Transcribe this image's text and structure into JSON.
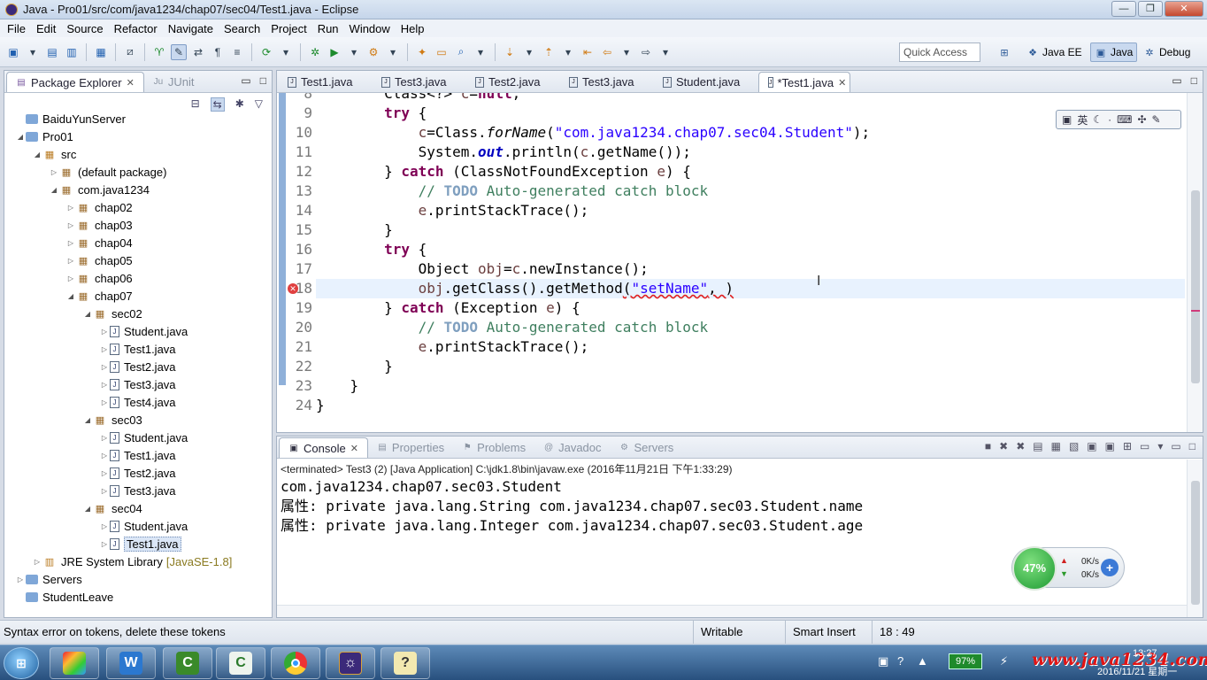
{
  "window": {
    "title": "Java - Pro01/src/com/java1234/chap07/sec04/Test1.java - Eclipse"
  },
  "menu": [
    "File",
    "Edit",
    "Source",
    "Refactor",
    "Navigate",
    "Search",
    "Project",
    "Run",
    "Window",
    "Help"
  ],
  "toolbar": {
    "quick_access_placeholder": "Quick Access",
    "perspectives": [
      "Java EE",
      "Java",
      "Debug"
    ],
    "active_perspective": "Java"
  },
  "explorer": {
    "tabs": [
      "Package Explorer",
      "JUnit"
    ],
    "tree": [
      {
        "label": "BaiduYunServer",
        "depth": 0,
        "arrow": "",
        "icon": "project"
      },
      {
        "label": "Pro01",
        "depth": 0,
        "arrow": "down",
        "icon": "project"
      },
      {
        "label": "src",
        "depth": 1,
        "arrow": "down",
        "icon": "src"
      },
      {
        "label": "(default package)",
        "depth": 2,
        "arrow": "right",
        "icon": "pkg"
      },
      {
        "label": "com.java1234",
        "depth": 2,
        "arrow": "down",
        "icon": "pkg"
      },
      {
        "label": "chap02",
        "depth": 3,
        "arrow": "right",
        "icon": "pkg"
      },
      {
        "label": "chap03",
        "depth": 3,
        "arrow": "right",
        "icon": "pkg"
      },
      {
        "label": "chap04",
        "depth": 3,
        "arrow": "right",
        "icon": "pkg"
      },
      {
        "label": "chap05",
        "depth": 3,
        "arrow": "right",
        "icon": "pkg"
      },
      {
        "label": "chap06",
        "depth": 3,
        "arrow": "right",
        "icon": "pkg"
      },
      {
        "label": "chap07",
        "depth": 3,
        "arrow": "down",
        "icon": "pkg"
      },
      {
        "label": "sec02",
        "depth": 4,
        "arrow": "down",
        "icon": "pkg"
      },
      {
        "label": "Student.java",
        "depth": 5,
        "arrow": "right",
        "icon": "file"
      },
      {
        "label": "Test1.java",
        "depth": 5,
        "arrow": "right",
        "icon": "file"
      },
      {
        "label": "Test2.java",
        "depth": 5,
        "arrow": "right",
        "icon": "file"
      },
      {
        "label": "Test3.java",
        "depth": 5,
        "arrow": "right",
        "icon": "file"
      },
      {
        "label": "Test4.java",
        "depth": 5,
        "arrow": "right",
        "icon": "file"
      },
      {
        "label": "sec03",
        "depth": 4,
        "arrow": "down",
        "icon": "pkg"
      },
      {
        "label": "Student.java",
        "depth": 5,
        "arrow": "right",
        "icon": "file"
      },
      {
        "label": "Test1.java",
        "depth": 5,
        "arrow": "right",
        "icon": "file"
      },
      {
        "label": "Test2.java",
        "depth": 5,
        "arrow": "right",
        "icon": "file"
      },
      {
        "label": "Test3.java",
        "depth": 5,
        "arrow": "right",
        "icon": "file"
      },
      {
        "label": "sec04",
        "depth": 4,
        "arrow": "down",
        "icon": "pkg"
      },
      {
        "label": "Student.java",
        "depth": 5,
        "arrow": "right",
        "icon": "file"
      },
      {
        "label": "Test1.java",
        "depth": 5,
        "arrow": "right",
        "icon": "file",
        "selected": true
      },
      {
        "label": "JRE System Library",
        "suffix": "[JavaSE-1.8]",
        "depth": 1,
        "arrow": "right",
        "icon": "jre"
      },
      {
        "label": "Servers",
        "depth": 0,
        "arrow": "right",
        "icon": "project"
      },
      {
        "label": "StudentLeave",
        "depth": 0,
        "arrow": "",
        "icon": "project"
      }
    ]
  },
  "editor": {
    "tabs": [
      {
        "label": "Test1.java",
        "active": false
      },
      {
        "label": "Test3.java",
        "active": false
      },
      {
        "label": "Test2.java",
        "active": false
      },
      {
        "label": "Test3.java",
        "active": false
      },
      {
        "label": "Student.java",
        "active": false
      },
      {
        "label": "*Test1.java",
        "active": true
      }
    ],
    "current_line": 18,
    "lines": [
      {
        "n": "8",
        "tokens": [
          [
            "",
            "        "
          ],
          [
            "",
            "Class<?> "
          ],
          [
            "var",
            "c"
          ],
          [
            "",
            "="
          ],
          [
            "kw",
            "null"
          ],
          [
            "",
            ";"
          ]
        ]
      },
      {
        "n": "9",
        "tokens": [
          [
            "",
            "        "
          ],
          [
            "kw",
            "try"
          ],
          [
            "",
            " {"
          ]
        ]
      },
      {
        "n": "10",
        "tokens": [
          [
            "",
            "            "
          ],
          [
            "var",
            "c"
          ],
          [
            "",
            "=Class."
          ],
          [
            "it",
            "forName"
          ],
          [
            "",
            "("
          ],
          [
            "str",
            "\"com.java1234.chap07.sec04.Student\""
          ],
          [
            "",
            ");"
          ]
        ]
      },
      {
        "n": "11",
        "tokens": [
          [
            "",
            "            System."
          ],
          [
            "fld",
            "out"
          ],
          [
            "",
            ".println("
          ],
          [
            "var",
            "c"
          ],
          [
            "",
            ".getName());"
          ]
        ]
      },
      {
        "n": "12",
        "tokens": [
          [
            "",
            "        } "
          ],
          [
            "kw",
            "catch"
          ],
          [
            "",
            " (ClassNotFoundException "
          ],
          [
            "var",
            "e"
          ],
          [
            "",
            ") {"
          ]
        ]
      },
      {
        "n": "13",
        "tokens": [
          [
            "",
            "            "
          ],
          [
            "cm",
            "// "
          ],
          [
            "todo",
            "TODO"
          ],
          [
            "cm",
            " Auto-generated catch block"
          ]
        ]
      },
      {
        "n": "14",
        "tokens": [
          [
            "",
            "            "
          ],
          [
            "var",
            "e"
          ],
          [
            "",
            ".printStackTrace();"
          ]
        ]
      },
      {
        "n": "15",
        "tokens": [
          [
            "",
            "        }"
          ]
        ]
      },
      {
        "n": "16",
        "tokens": [
          [
            "",
            "        "
          ],
          [
            "kw",
            "try"
          ],
          [
            "",
            " {"
          ]
        ]
      },
      {
        "n": "17",
        "tokens": [
          [
            "",
            "            Object "
          ],
          [
            "var",
            "obj"
          ],
          [
            "",
            "="
          ],
          [
            "var",
            "c"
          ],
          [
            "",
            ".newInstance();"
          ]
        ]
      },
      {
        "n": "18",
        "tokens": [
          [
            "",
            "            "
          ],
          [
            "var",
            "obj"
          ],
          [
            "",
            ".getClass().getMethod"
          ],
          [
            "err",
            "("
          ],
          [
            "str err",
            "\"setName\""
          ],
          [
            "err",
            ", )"
          ]
        ]
      },
      {
        "n": "19",
        "tokens": [
          [
            "",
            "        } "
          ],
          [
            "kw",
            "catch"
          ],
          [
            "",
            " (Exception "
          ],
          [
            "var",
            "e"
          ],
          [
            "",
            ") {"
          ]
        ]
      },
      {
        "n": "20",
        "tokens": [
          [
            "",
            "            "
          ],
          [
            "cm",
            "// "
          ],
          [
            "todo",
            "TODO"
          ],
          [
            "cm",
            " Auto-generated catch block"
          ]
        ]
      },
      {
        "n": "21",
        "tokens": [
          [
            "",
            "            "
          ],
          [
            "var",
            "e"
          ],
          [
            "",
            ".printStackTrace();"
          ]
        ]
      },
      {
        "n": "22",
        "tokens": [
          [
            "",
            "        }"
          ]
        ]
      },
      {
        "n": "23",
        "tokens": [
          [
            "",
            "    }"
          ]
        ]
      },
      {
        "n": "24",
        "tokens": [
          [
            "",
            "}"
          ]
        ]
      }
    ],
    "ime_label": "英"
  },
  "console": {
    "tabs": [
      "Console",
      "Properties",
      "Problems",
      "Javadoc",
      "Servers"
    ],
    "terminated": "<terminated> Test3 (2) [Java Application] C:\\jdk1.8\\bin\\javaw.exe (2016年11月21日 下午1:33:29)",
    "output": [
      "com.java1234.chap07.sec03.Student",
      "属性: private java.lang.String com.java1234.chap07.sec03.Student.name",
      "属性: private java.lang.Integer com.java1234.chap07.sec03.Student.age"
    ]
  },
  "speed_widget": {
    "percent": "47%",
    "up": "0K/s",
    "down": "0K/s"
  },
  "status": {
    "message": "Syntax error on tokens, delete these tokens",
    "writable": "Writable",
    "insert_mode": "Smart Insert",
    "position": "18 : 49"
  },
  "taskbar": {
    "battery": "97%",
    "watermark": "www.java1234.com",
    "time": "13:27",
    "date": "2016/11/21 星期一"
  },
  "colors": {
    "keyword": "#7f0055",
    "string": "#2a00ff",
    "comment": "#3f7f5f",
    "current_line": "#e8f2fe",
    "error": "#e02020"
  }
}
